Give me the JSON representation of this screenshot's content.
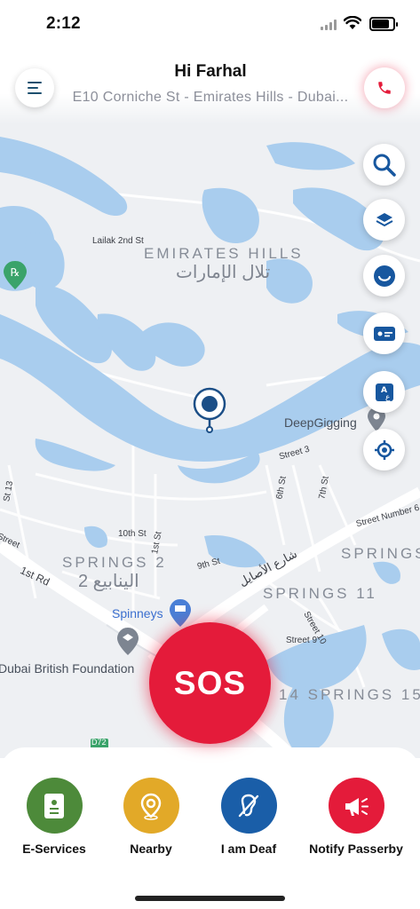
{
  "status": {
    "time": "2:12"
  },
  "header": {
    "greeting": "Hi Farhal",
    "address": "E10 Corniche St - Emirates Hills - Dubai..."
  },
  "icons": {
    "menu": "menu-icon",
    "call": "phone-icon",
    "search": "search-icon",
    "layers": "layers-icon",
    "face": "smile-icon",
    "card": "id-card-icon",
    "translate": "translate-icon",
    "locate": "crosshair-icon"
  },
  "map": {
    "labels": {
      "lailak": "Lailak 2nd St",
      "emirates_hills": "EMIRATES HILLS",
      "emirates_hills_ar": "تلال الإمارات",
      "deepgigging": "DeepGigging",
      "street3": "Street 3",
      "sixth": "6th St",
      "seventh": "7th St",
      "street_number6": "Street Number 6",
      "st13": "St 13",
      "tenth": "10th St",
      "firstst": "1st St",
      "street_left": "Street",
      "springs2": "SPRINGS 2",
      "springs2_ar": "الينابيع 2",
      "ninth": "9th St",
      "asayel": "شارع الأصايل",
      "springs_right": "SPRINGS",
      "springs11": "SPRINGS 11",
      "first_rd": "1st Rd",
      "spinneys": "Spinneys",
      "street10": "Street 10",
      "street9": "Street 9",
      "dubai_british": "Dubai British Foundation",
      "springs15": "14 SPRINGS 15",
      "d72": "D72"
    }
  },
  "sos": {
    "label": "SOS"
  },
  "bottom_nav": [
    {
      "label": "E-Services",
      "color": "#4d8a3a"
    },
    {
      "label": "Nearby",
      "color": "#e2a928"
    },
    {
      "label": "I am Deaf",
      "color": "#1a5ea8"
    },
    {
      "label": "Notify Passerby",
      "color": "#e41b3a"
    }
  ],
  "colors": {
    "water": "#a9cdee",
    "land": "#eef0f3",
    "accent_red": "#e41b3a",
    "nav_blue": "#17579f"
  }
}
